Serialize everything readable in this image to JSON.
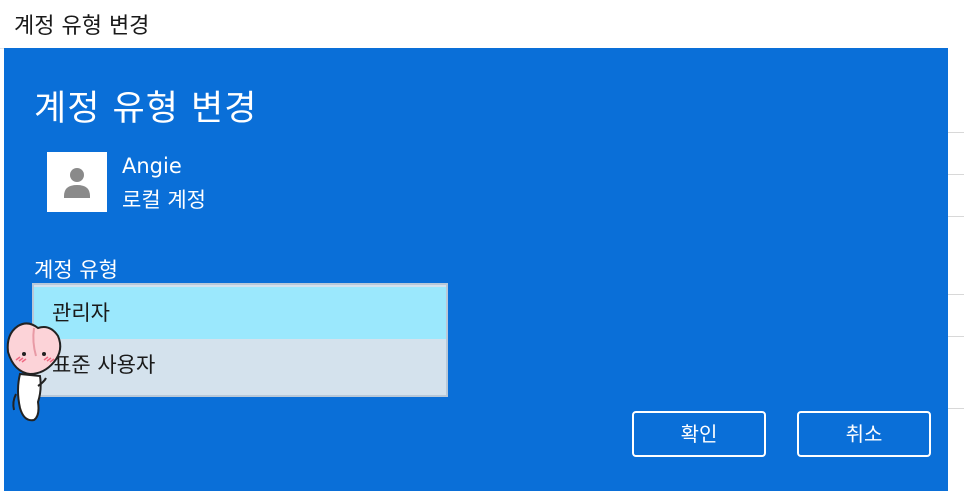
{
  "window": {
    "title": "계정 유형 변경"
  },
  "dialog": {
    "heading": "계정 유형 변경",
    "user": {
      "name": "Angie",
      "account_kind": "로컬 계정",
      "avatar_icon": "user-silhouette-icon"
    },
    "account_type_label": "계정 유형",
    "account_type_options": [
      {
        "label": "관리자",
        "selected": true
      },
      {
        "label": "표준 사용자",
        "selected": false
      }
    ],
    "buttons": {
      "ok": "확인",
      "cancel": "취소"
    }
  },
  "colors": {
    "dialog_background": "#0a6fd8",
    "selected_option": "#9be8fd",
    "listbox_background": "#d4e2ed",
    "text_on_blue": "#ffffff"
  }
}
